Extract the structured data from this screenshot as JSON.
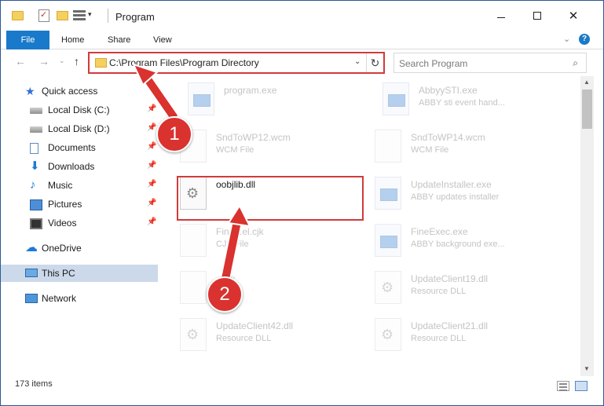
{
  "window": {
    "title": "Program",
    "controls": {
      "minimize": "",
      "maximize": "",
      "close": "✕"
    }
  },
  "ribbon": {
    "tabs": [
      "File",
      "Home",
      "Share",
      "View"
    ],
    "help_label": "?"
  },
  "address_bar": {
    "path": "C:\\Program Files\\Program Directory",
    "refresh_glyph": "↻"
  },
  "search": {
    "placeholder": "Search Program",
    "icon_glyph": "⌕"
  },
  "nav": {
    "back": "←",
    "forward": "→",
    "dropdown": "⌄",
    "up": "↑"
  },
  "sidebar": {
    "quick_access_label": "Quick access",
    "items": [
      {
        "label": "Local Disk (C:)",
        "icon": "local-disk-icon",
        "pinned": true
      },
      {
        "label": "Local Disk (D:)",
        "icon": "local-disk-icon",
        "pinned": true
      },
      {
        "label": "Documents",
        "icon": "documents-icon",
        "pinned": true
      },
      {
        "label": "Downloads",
        "icon": "downloads-icon",
        "pinned": true
      },
      {
        "label": "Music",
        "icon": "music-icon",
        "pinned": true
      },
      {
        "label": "Pictures",
        "icon": "pictures-icon",
        "pinned": true
      },
      {
        "label": "Videos",
        "icon": "videos-icon",
        "pinned": true
      }
    ],
    "onedrive_label": "OneDrive",
    "thispc_label": "This PC",
    "network_label": "Network",
    "pin_glyph": "📌"
  },
  "files": [
    {
      "name": "program.exe",
      "type": "",
      "kind": "exe",
      "faded": true
    },
    {
      "name": "AbbyySTI.exe",
      "type": "ABBY sti event hand...",
      "kind": "exe",
      "faded": true
    },
    {
      "name": "SndToWP12.wcm",
      "type": "WCM File",
      "kind": "file",
      "faded": true
    },
    {
      "name": "SndToWP14.wcm",
      "type": "WCM File",
      "kind": "file",
      "faded": true
    },
    {
      "name": "oobjlib.dll",
      "type": "",
      "kind": "dll",
      "faded": false
    },
    {
      "name": "UpdateInstaller.exe",
      "type": "ABBY updates installer",
      "kind": "exe",
      "faded": true
    },
    {
      "name": "Fine...el.cjk",
      "type": "CJK File",
      "kind": "file",
      "faded": true
    },
    {
      "name": "FineExec.exe",
      "type": "ABBY background exe...",
      "kind": "exe",
      "faded": true
    },
    {
      "name": "...cjk",
      "type": "...File",
      "kind": "file",
      "faded": true
    },
    {
      "name": "UpdateClient19.dll",
      "type": "Resource DLL",
      "kind": "dll",
      "faded": true
    },
    {
      "name": "UpdateClient42.dll",
      "type": "Resource DLL",
      "kind": "dll",
      "faded": true
    },
    {
      "name": "UpdateClient21.dll",
      "type": "Resource DLL",
      "kind": "dll",
      "faded": true
    }
  ],
  "status": {
    "item_count": "173 items"
  },
  "annotations": {
    "step1": "1",
    "step2": "2"
  },
  "colors": {
    "accent": "#1979ca",
    "highlight": "#d23a3a",
    "badge": "#d9322f"
  }
}
